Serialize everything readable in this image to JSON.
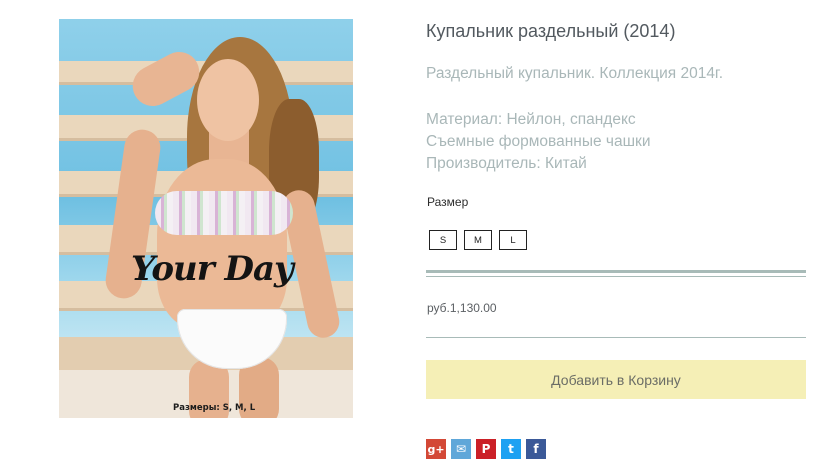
{
  "product": {
    "image": {
      "overlay_text": "Your Day",
      "sizes_caption": "Размеры: S, M, L"
    },
    "title": "Купальник раздельный (2014)",
    "description": "Раздельный купальник. Коллекция 2014г.",
    "attributes": [
      "Материал: Нейлон, спандекс",
      "Съемные формованные чашки",
      "Производитель: Китай"
    ],
    "size_label": "Размер",
    "sizes": [
      "S",
      "M",
      "L"
    ],
    "price": "руб.1,130.00",
    "add_to_cart_label": "Добавить в Корзину"
  },
  "social": [
    {
      "name": "google-plus-icon",
      "glyph": "g+",
      "color": "#d34836"
    },
    {
      "name": "vk-icon",
      "glyph": "✉",
      "color": "#5fa7d9"
    },
    {
      "name": "pinterest-icon",
      "glyph": "P",
      "color": "#cb2027"
    },
    {
      "name": "twitter-icon",
      "glyph": "t",
      "color": "#1da1f2"
    },
    {
      "name": "facebook-icon",
      "glyph": "f",
      "color": "#3b5998"
    }
  ],
  "colors": {
    "add_to_cart_bg": "#f5efb6",
    "rule": "#a8bbb8",
    "muted_text": "#a9b7b8"
  }
}
